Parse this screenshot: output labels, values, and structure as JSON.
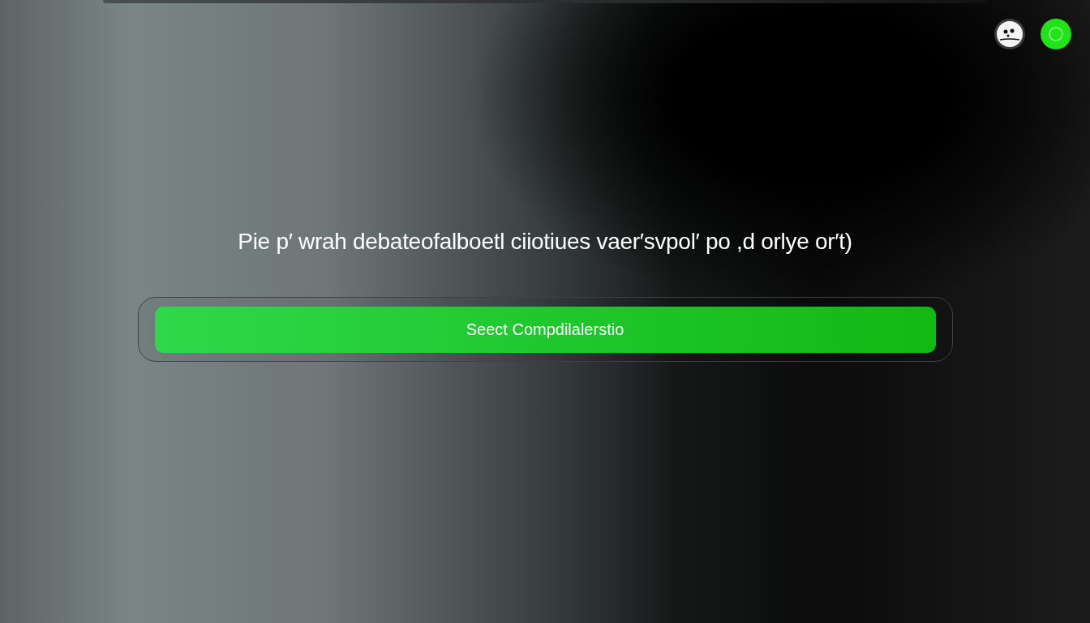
{
  "heading": "Pie p′ wrah debateofalboetl ciiotiues vaer′svpol′ po ,d orlye or′t)",
  "primary_button": {
    "label": "Seect Compdilalerstio"
  }
}
